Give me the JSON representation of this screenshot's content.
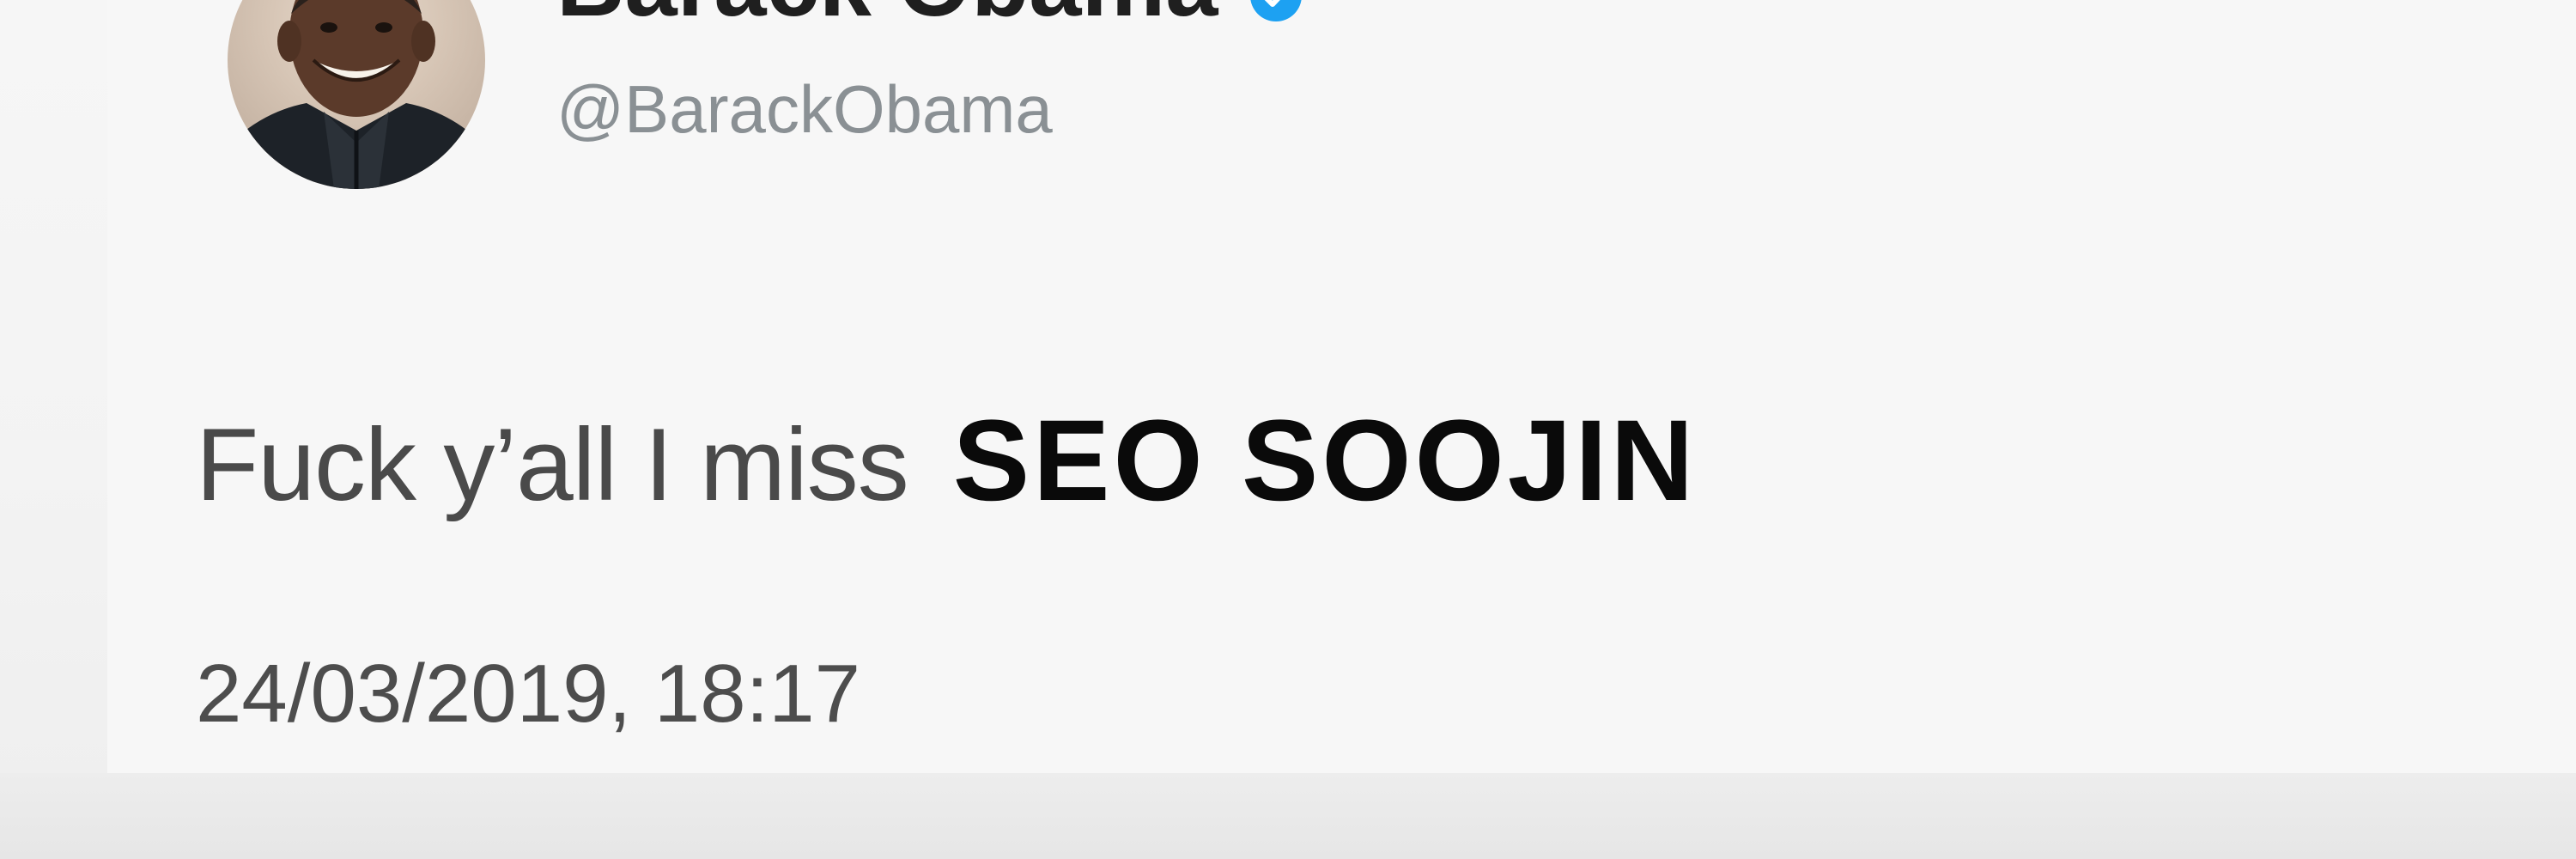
{
  "tweet": {
    "author": {
      "display_name": "Barack Obama",
      "handle": "@BarackObama",
      "verified": true,
      "avatar": "profile-photo"
    },
    "text_prefix": "Fuck y’all I miss",
    "text_emphasis": "SEO SOOJIN",
    "timestamp": "24/03/2019, 18:17"
  },
  "icons": {
    "verified": "verified-badge-icon",
    "menu": "chevron-down-icon"
  },
  "colors": {
    "background": "#f7f7f7",
    "name_text": "#1f1f1f",
    "handle_text": "#8a9094",
    "body_text": "#4a4a4a",
    "emphasis_text": "#0a0a0a",
    "verified_badge": "#1da1f2"
  }
}
